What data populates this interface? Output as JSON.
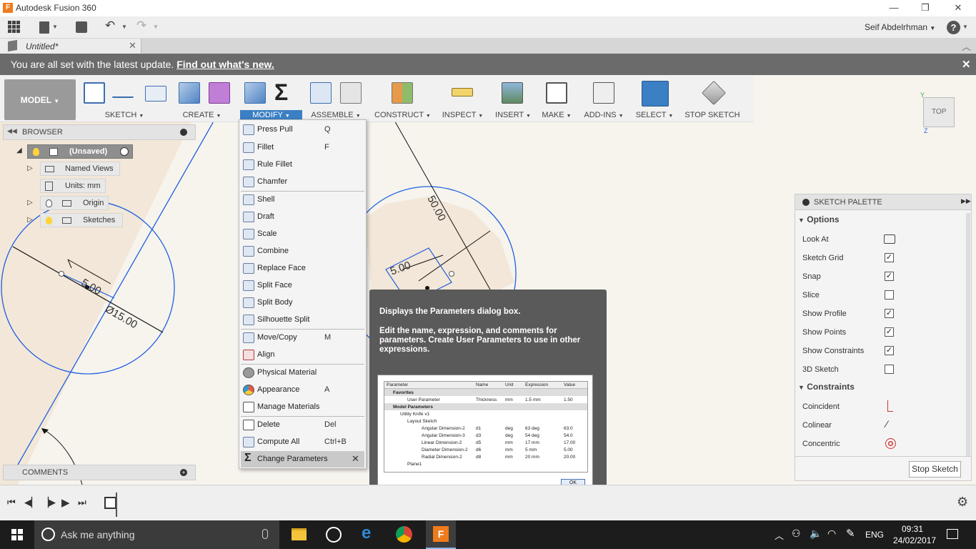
{
  "window": {
    "title": "Autodesk Fusion 360"
  },
  "appbar": {
    "user": "Seif Abdelrhman",
    "help": "?"
  },
  "document": {
    "tab_title": "Untitled*"
  },
  "banner": {
    "text": "You are all set with the latest update. ",
    "link": "Find out what's new."
  },
  "ribbon": {
    "workspace": "MODEL",
    "groups": {
      "sketch": "SKETCH",
      "create": "CREATE",
      "modify": "MODIFY",
      "assemble": "ASSEMBLE",
      "construct": "CONSTRUCT",
      "inspect": "INSPECT",
      "insert": "INSERT",
      "make": "MAKE",
      "addins": "ADD-INS",
      "select": "SELECT",
      "stop_sketch": "STOP SKETCH"
    }
  },
  "viewcube": {
    "face": "TOP"
  },
  "browser": {
    "title": "BROWSER",
    "root": "(Unsaved)",
    "named_views": "Named Views",
    "units": "Units: mm",
    "origin": "Origin",
    "sketches": "Sketches"
  },
  "comments": {
    "title": "COMMENTS"
  },
  "modify_menu": {
    "items": [
      {
        "label": "Press Pull",
        "shortcut": "Q"
      },
      {
        "label": "Fillet",
        "shortcut": "F"
      },
      {
        "label": "Rule Fillet",
        "shortcut": ""
      },
      {
        "label": "Chamfer",
        "shortcut": ""
      },
      {
        "label": "Shell",
        "shortcut": ""
      },
      {
        "label": "Draft",
        "shortcut": ""
      },
      {
        "label": "Scale",
        "shortcut": ""
      },
      {
        "label": "Combine",
        "shortcut": ""
      },
      {
        "label": "Replace Face",
        "shortcut": ""
      },
      {
        "label": "Split Face",
        "shortcut": ""
      },
      {
        "label": "Split Body",
        "shortcut": ""
      },
      {
        "label": "Silhouette Split",
        "shortcut": ""
      },
      {
        "label": "Move/Copy",
        "shortcut": "M"
      },
      {
        "label": "Align",
        "shortcut": ""
      },
      {
        "label": "Physical Material",
        "shortcut": ""
      },
      {
        "label": "Appearance",
        "shortcut": "A"
      },
      {
        "label": "Manage Materials",
        "shortcut": ""
      },
      {
        "label": "Delete",
        "shortcut": "Del"
      },
      {
        "label": "Compute All",
        "shortcut": "Ctrl+B"
      },
      {
        "label": "Change Parameters",
        "shortcut": ""
      }
    ]
  },
  "tooltip": {
    "title": "Displays the Parameters dialog box.",
    "body": "Edit the name, expression, and comments for parameters. Create User Parameters to use in other expressions.",
    "preview": {
      "headers": [
        "Parameter",
        "Name",
        "Unit",
        "Expression",
        "Value"
      ],
      "rows": [
        [
          "Favorites",
          "",
          "",
          "",
          ""
        ],
        [
          "User Parameter",
          "Thickness",
          "mm",
          "1.5 mm",
          "1.50"
        ],
        [
          "Model Parameters",
          "",
          "",
          "",
          ""
        ],
        [
          "Utility Knife v1",
          "",
          "",
          "",
          ""
        ],
        [
          "Layout Sketch",
          "",
          "",
          "",
          ""
        ],
        [
          "Angular Dimension-2",
          "d1",
          "deg",
          "63 deg",
          "63.0"
        ],
        [
          "Angular Dimension-3",
          "d3",
          "deg",
          "54 deg",
          "54.0"
        ],
        [
          "Linear Dimension-2",
          "d5",
          "mm",
          "17 mm",
          "17.00"
        ],
        [
          "Diameter Dimension-2",
          "d6",
          "mm",
          "5 mm",
          "5.00"
        ],
        [
          "Radial Dimension-2",
          "d8",
          "mm",
          "20 mm",
          "20.00"
        ],
        [
          "Plane1",
          "",
          "",
          "",
          ""
        ]
      ],
      "ok": "OK"
    }
  },
  "sketch_palette": {
    "title": "SKETCH PALETTE",
    "options_header": "Options",
    "options": [
      {
        "label": "Look At",
        "checked": null
      },
      {
        "label": "Sketch Grid",
        "checked": true
      },
      {
        "label": "Snap",
        "checked": true
      },
      {
        "label": "Slice",
        "checked": false
      },
      {
        "label": "Show Profile",
        "checked": true
      },
      {
        "label": "Show Points",
        "checked": true
      },
      {
        "label": "Show Constraints",
        "checked": true
      },
      {
        "label": "3D Sketch",
        "checked": false
      }
    ],
    "constraints_header": "Constraints",
    "constraints": [
      "Coincident",
      "Colinear",
      "Concentric"
    ],
    "stop_button": "Stop Sketch"
  },
  "dimensions": {
    "d1": "5.00",
    "d2": "Ø15.00",
    "d3": "50.00",
    "d4": "5.00"
  },
  "taskbar": {
    "search": "Ask me anything",
    "lang": "ENG",
    "time": "09:31",
    "date": "24/02/2017"
  },
  "colors": {
    "accent": "#1f6fd1",
    "select": "#3b7fc4",
    "banner": "#6b6b6b"
  }
}
